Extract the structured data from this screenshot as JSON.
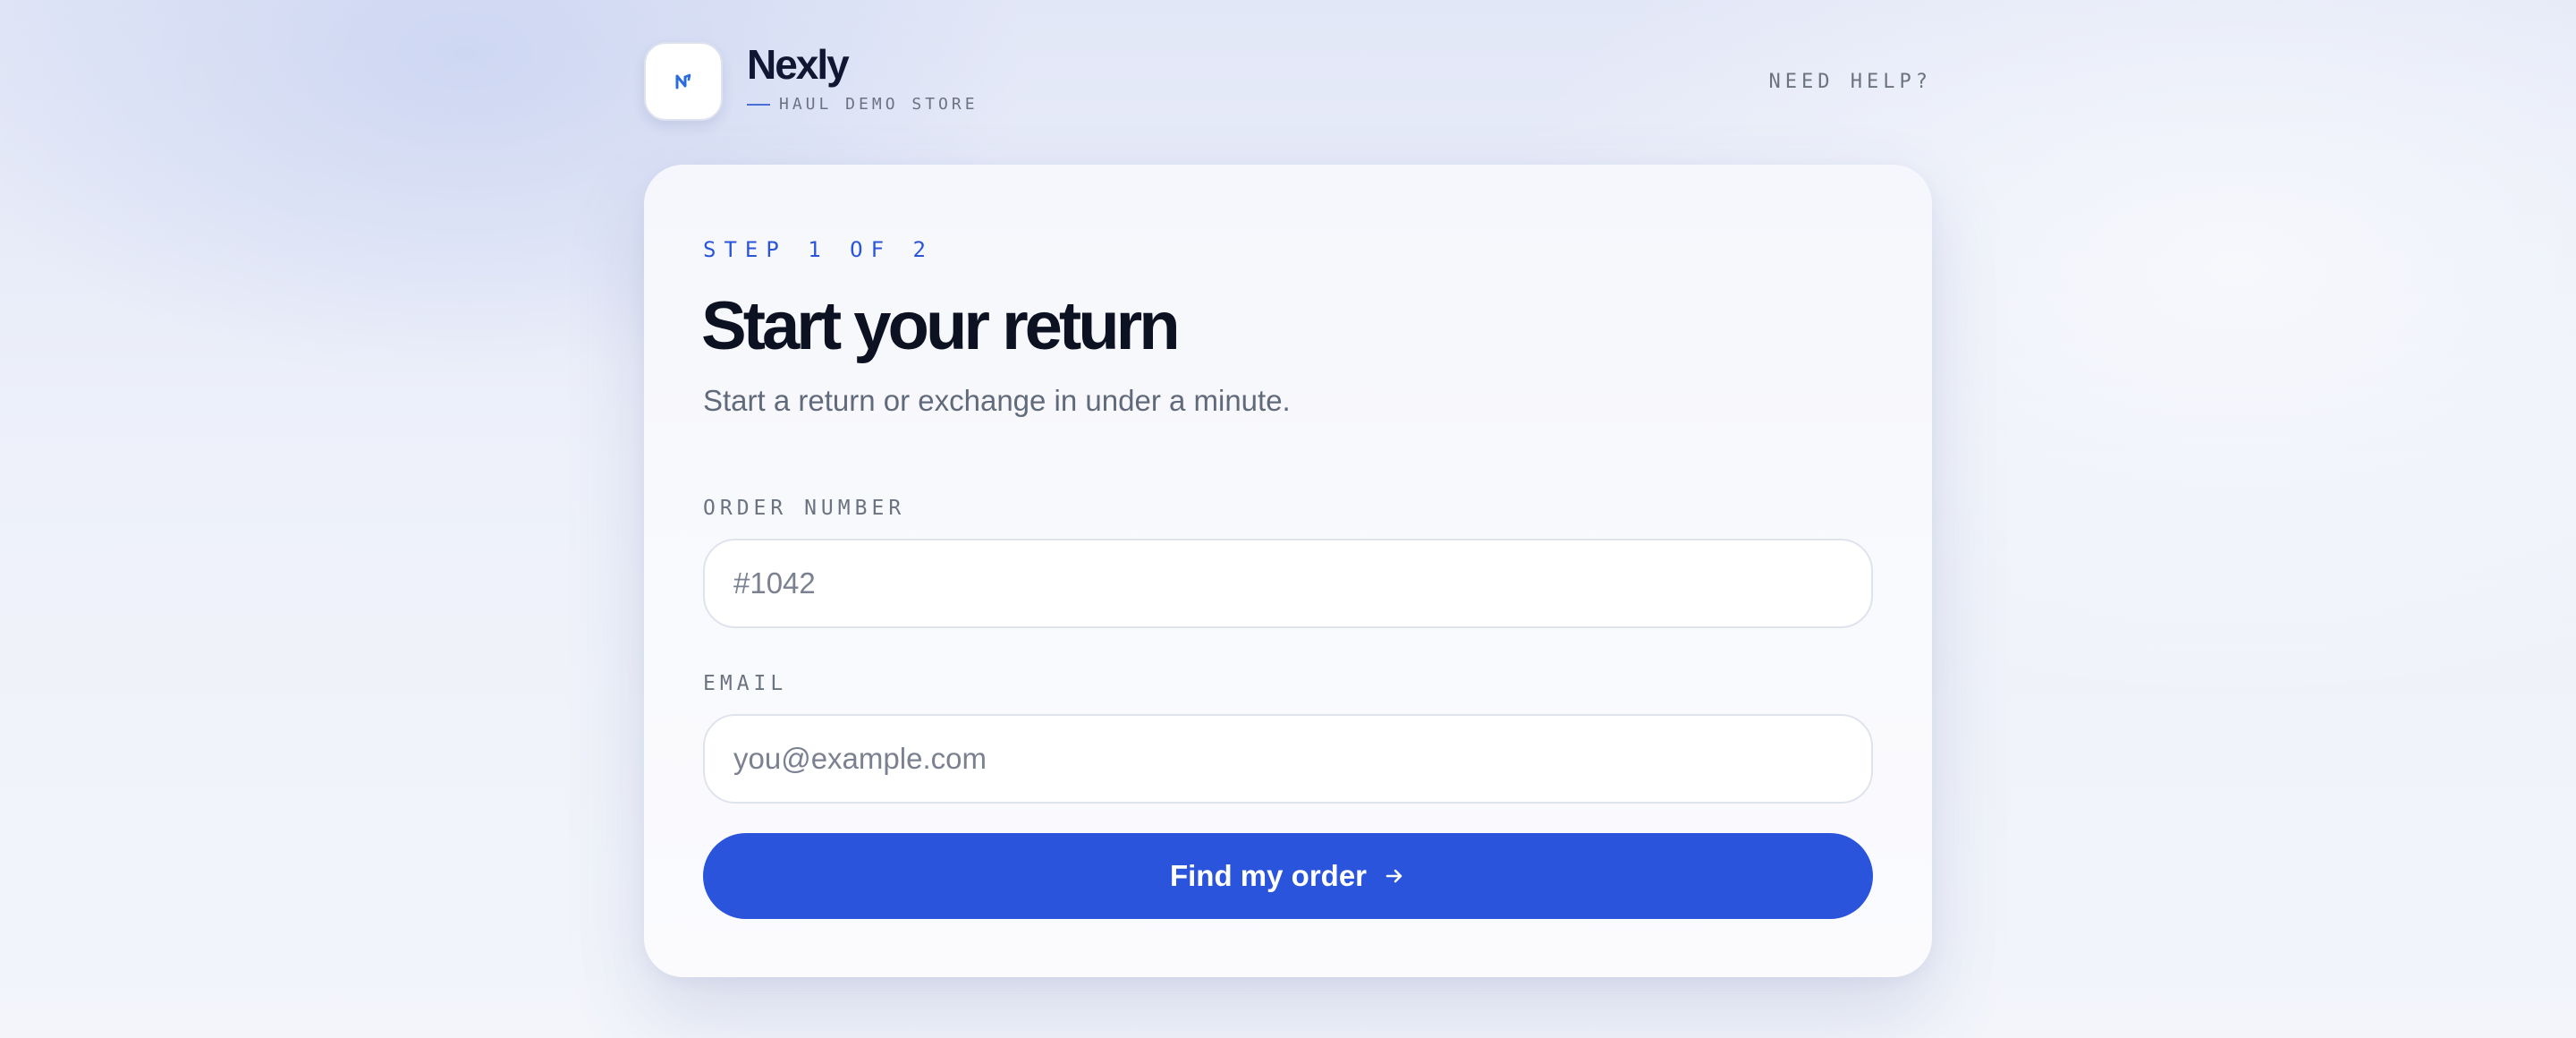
{
  "brand": {
    "name": "Nexly",
    "subtitle": "HAUL DEMO STORE",
    "logo_icon": "nexly-logo-icon",
    "accent_color": "#2954db"
  },
  "header": {
    "help_link": "NEED HELP?"
  },
  "form": {
    "step": "STEP 1 OF 2",
    "title": "Start your return",
    "subtitle": "Start a return or exchange in under a minute.",
    "order_number": {
      "label": "ORDER NUMBER",
      "value": "",
      "placeholder": "#1042"
    },
    "email": {
      "label": "EMAIL",
      "value": "",
      "placeholder": "you@example.com"
    },
    "submit": {
      "label": "Find my order",
      "icon": "arrow-right-icon"
    }
  }
}
